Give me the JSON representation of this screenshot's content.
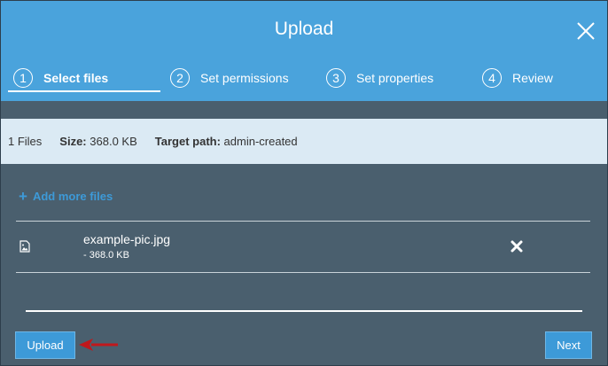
{
  "dialog": {
    "title": "Upload",
    "close_icon": "close-icon"
  },
  "steps": [
    {
      "number": "1",
      "label": "Select files",
      "active": true
    },
    {
      "number": "2",
      "label": "Set permissions",
      "active": false
    },
    {
      "number": "3",
      "label": "Set properties",
      "active": false
    },
    {
      "number": "4",
      "label": "Review",
      "active": false
    }
  ],
  "summary": {
    "files_count": "1 Files",
    "size_label": "Size:",
    "size_value": "368.0 KB",
    "target_label": "Target path:",
    "target_value": "admin-created"
  },
  "add_more": {
    "label": "Add more files",
    "icon": "plus-icon"
  },
  "files": [
    {
      "name": "example-pic.jpg",
      "size": "- 368.0 KB",
      "icon": "image-file-icon",
      "remove_icon": "close-icon"
    }
  ],
  "buttons": {
    "upload_label": "Upload",
    "next_label": "Next"
  },
  "colors": {
    "header": "#4aa3dc",
    "body": "#4a5f6e",
    "summary_bg": "#dbeaf4",
    "accent": "#3d9ad8",
    "annotation_arrow": "#c0181c"
  }
}
